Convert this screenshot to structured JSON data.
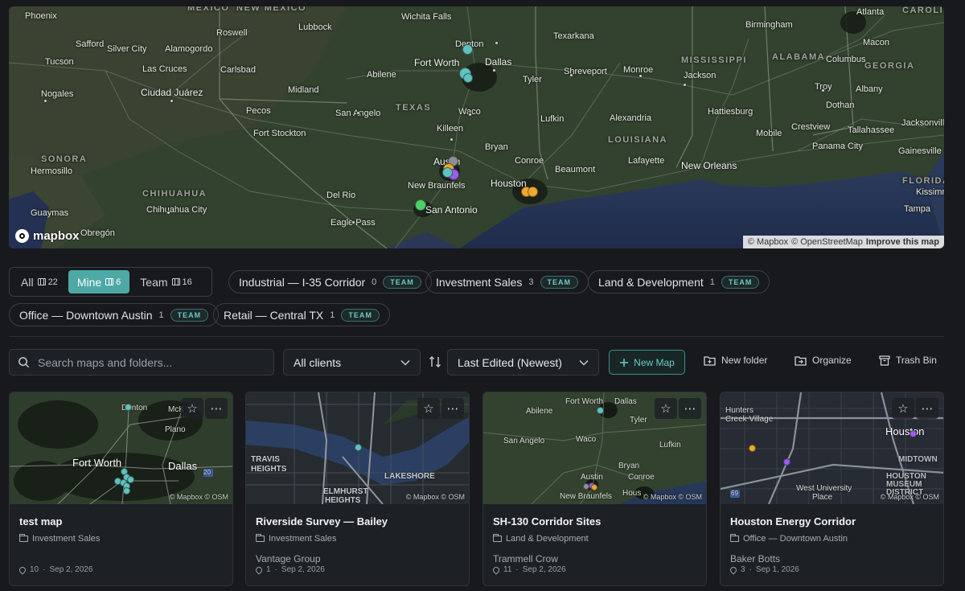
{
  "hero_map": {
    "states": [
      "MEXICO",
      "NEW MEXICO",
      "TEXAS",
      "LOUISIANA",
      "MISSISSIPPI",
      "ALABAMA",
      "GEORGIA",
      "CAROLINA",
      "FLORIDA",
      "SONORA",
      "CHIHUAHUA"
    ],
    "cities": [
      "Phoenix",
      "Wichita Falls",
      "Atlanta",
      "Lubbock",
      "Roswell",
      "Safford",
      "Silver City",
      "Alamogordo",
      "Texarkana",
      "Birmingham",
      "Denton",
      "Fort Worth",
      "Dallas",
      "Tucson",
      "Las Cruces",
      "Carlsbad",
      "Abilene",
      "Shreveport",
      "Monroe",
      "Jackson",
      "Macon",
      "Columbus",
      "Nogales",
      "Ciudad Juárez",
      "Midland",
      "Tyler",
      "Troy",
      "Albany",
      "San Angelo",
      "Waco",
      "Hattiesburg",
      "Pecos",
      "Dothan",
      "Fort Stockton",
      "Lufkin",
      "Alexandria",
      "Crestview",
      "Tallahassee",
      "Jacksonville",
      "Killeen",
      "Mobile",
      "Panama City",
      "Hermosillo",
      "Bryan",
      "Gainesville",
      "Austin",
      "Conroe",
      "Lafayette",
      "New Orleans",
      "Beaumont",
      "Houston",
      "New Braunfels",
      "Del Rio",
      "Kissimmee",
      "Chihuahua City",
      "San Antonio",
      "Tampa",
      "Guaymas",
      "Eagle Pass",
      "Obregón"
    ],
    "logo": "mapbox",
    "attribution": {
      "a": "© Mapbox",
      "b": "© OpenStreetMap",
      "c": "Improve this map"
    }
  },
  "filters": {
    "all": {
      "label": "All",
      "count": "22"
    },
    "mine": {
      "label": "Mine",
      "count": "6"
    },
    "team": {
      "label": "Team",
      "count": "16"
    },
    "folders": [
      {
        "label": "Industrial — I-35 Corridor",
        "count": "0",
        "badge": "TEAM"
      },
      {
        "label": "Investment Sales",
        "count": "3",
        "badge": "TEAM"
      },
      {
        "label": "Land & Development",
        "count": "1",
        "badge": "TEAM"
      },
      {
        "label": "Office — Downtown Austin",
        "count": "1",
        "badge": "TEAM"
      },
      {
        "label": "Retail — Central TX",
        "count": "1",
        "badge": "TEAM"
      }
    ]
  },
  "toolbar": {
    "search_placeholder": "Search maps and folders...",
    "client_select": "All clients",
    "sort_select": "Last Edited (Newest)",
    "new_map": "New Map",
    "new_folder": "New folder",
    "organize": "Organize",
    "trash": "Trash Bin"
  },
  "cards": [
    {
      "title": "test map",
      "folder": "Investment Sales",
      "client": "",
      "pins": "10",
      "date": "Sep 2, 2026",
      "attribution": "© Mapbox © OSM",
      "labels": [
        "Denton",
        "McK",
        "Plano",
        "Fort Worth",
        "Dallas",
        "20"
      ]
    },
    {
      "title": "Riverside Survey — Bailey",
      "folder": "Investment Sales",
      "client": "Vantage Group",
      "pins": "1",
      "date": "Sep 2, 2026",
      "attribution": "© Mapbox © OSM",
      "labels": [
        "TRAVIS",
        "HEIGHTS",
        "ELMHURST",
        "HEIGHTS",
        "LAKESHORE"
      ]
    },
    {
      "title": "SH-130 Corridor Sites",
      "folder": "Land & Development",
      "client": "Trammell Crow",
      "pins": "11",
      "date": "Sep 2, 2026",
      "attribution": "© Mapbox © OSM",
      "labels": [
        "Fort Worth",
        "Dallas",
        "Abilene",
        "Tyler",
        "San Angelo",
        "Waco",
        "Lufkin",
        "Bryan",
        "Austin",
        "Conroe",
        "Hous",
        "New Braunfels"
      ]
    },
    {
      "title": "Houston Energy Corridor",
      "folder": "Office — Downtown Austin",
      "client": "Baker Botts",
      "pins": "3",
      "date": "Sep 1, 2026",
      "attribution": "© Mapbox © OSM",
      "labels": [
        "Hunters",
        "Creek Village",
        "Houston",
        "MIDTOWN",
        "HOUSTON",
        "MUSEUM",
        "DISTRICT",
        "West University",
        "Place",
        "69"
      ]
    }
  ],
  "colors": {
    "accent": "#4ea9a6",
    "teal_pin": "#5fc2bd",
    "green_pin": "#4fd16a",
    "orange_pin": "#f0a830",
    "purple_pin": "#9b5cf0",
    "gray_pin": "#8b9096"
  }
}
